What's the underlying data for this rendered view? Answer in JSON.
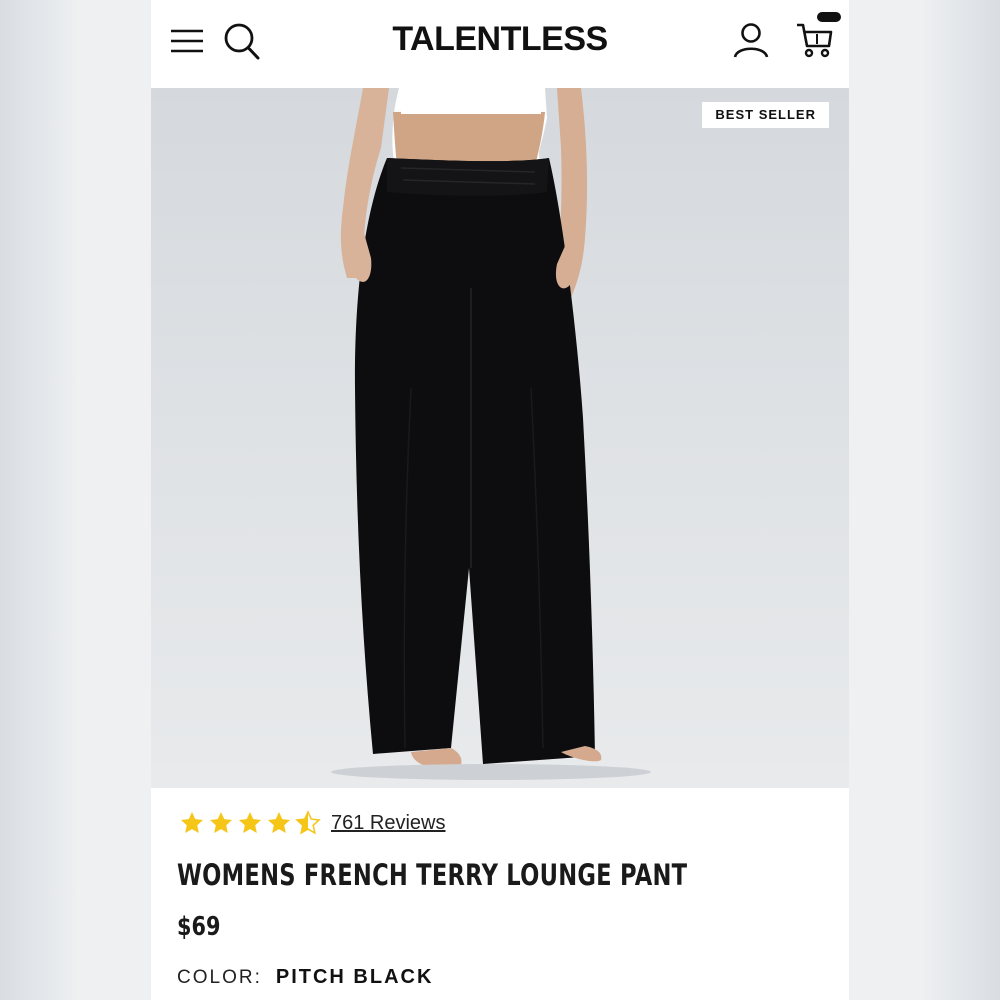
{
  "header": {
    "logo": "TALENTLESS",
    "icons": [
      "menu-icon",
      "search-icon",
      "account-icon",
      "cart-icon"
    ]
  },
  "product": {
    "badge": "BEST SELLER",
    "rating": 4.5,
    "reviews_label": "761 Reviews",
    "title": "WOMENS FRENCH TERRY LOUNGE PANT",
    "price": "$69",
    "color_label": "COLOR:",
    "color_value": "PITCH BLACK"
  },
  "colors": {
    "star": "#f5c518",
    "text": "#1a1a1a",
    "garment": "#0d0d0f"
  }
}
